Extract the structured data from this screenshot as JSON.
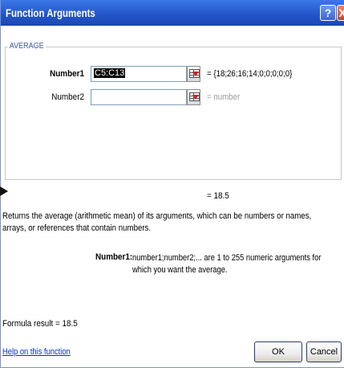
{
  "window": {
    "title": "Function Arguments",
    "help_label": "?",
    "close_label": "X"
  },
  "function_group": {
    "name": "AVERAGE"
  },
  "arguments": [
    {
      "label": "Number1",
      "input_value": "C5:C13",
      "evaluated": "= {18;26;16;14;0;0;0;0;0}"
    },
    {
      "label": "Number2",
      "input_value": "",
      "evaluated": "= number"
    }
  ],
  "result_line": "= 18.5",
  "description": "Returns the average (arithmetic mean) of its arguments, which can be numbers or names, arrays, or references that contain numbers.",
  "param_description": {
    "name": "Number1:",
    "text": "number1;number2;... are 1 to 255 numeric arguments for which you want the average."
  },
  "formula_result": "Formula result =  18.5",
  "help_link": "Help on this function",
  "buttons": {
    "ok": "OK",
    "cancel": "Cancel"
  },
  "icons": {
    "range_selector": "range-select-icon",
    "help": "help-icon",
    "close": "close-icon"
  },
  "colors": {
    "titlebar": "#2456c9",
    "group_label": "#3a56a8",
    "link": "#0033cc"
  }
}
